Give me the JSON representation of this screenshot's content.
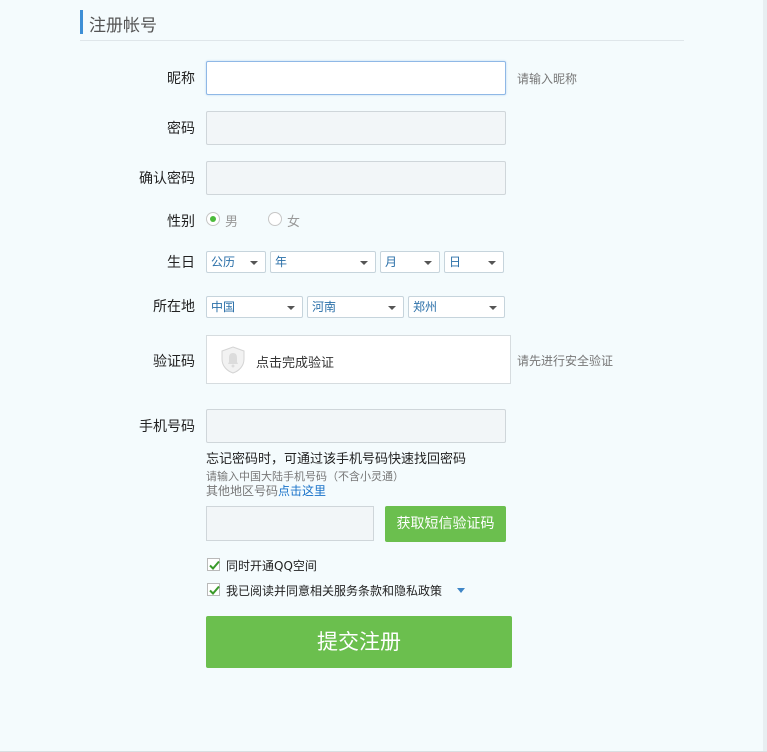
{
  "header": {
    "title": "注册帐号"
  },
  "form": {
    "nickname": {
      "label": "昵称",
      "value": "",
      "hint": "请输入昵称"
    },
    "password": {
      "label": "密码",
      "value": ""
    },
    "confirm_password": {
      "label": "确认密码",
      "value": ""
    },
    "gender": {
      "label": "性别",
      "options": [
        "男",
        "女"
      ],
      "selected": "男"
    },
    "birthday": {
      "label": "生日",
      "calendar": "公历",
      "year": "年",
      "month": "月",
      "day": "日"
    },
    "location": {
      "label": "所在地",
      "country": "中国",
      "province": "河南",
      "city": "郑州"
    },
    "captcha": {
      "label": "验证码",
      "button_text": "点击完成验证",
      "hint": "请先进行安全验证"
    },
    "phone": {
      "label": "手机号码",
      "value": "",
      "notice": "忘记密码时，可通过该手机号码快速找回密码",
      "sub_notice": "请输入中国大陆手机号码（不含小灵通）",
      "other_region_prefix": "其他地区号码",
      "other_region_link": "点击这里"
    },
    "sms": {
      "code_value": "",
      "button_label": "获取短信验证码"
    },
    "checkboxes": [
      {
        "label": "同时开通QQ空间",
        "checked": true
      },
      {
        "label": "我已阅读并同意相关服务条款和隐私政策",
        "checked": true
      }
    ],
    "submit_label": "提交注册"
  },
  "colors": {
    "accent_green": "#6bbf4e",
    "accent_blue": "#3d8fd6",
    "link": "#1a73c9"
  }
}
